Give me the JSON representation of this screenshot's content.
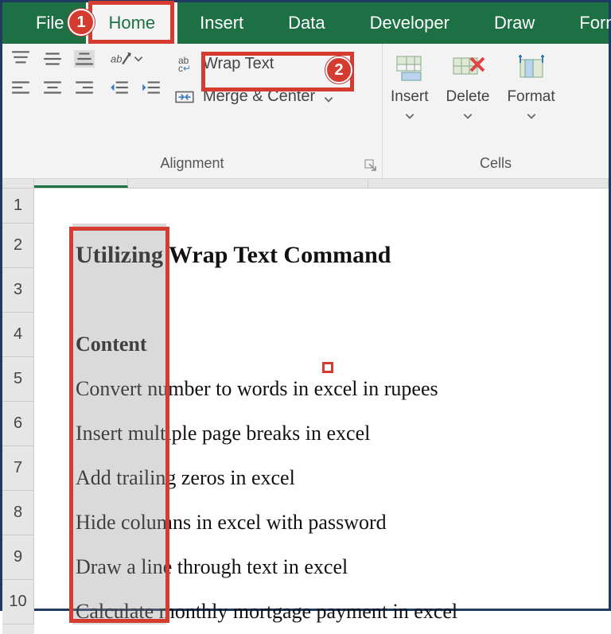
{
  "tabs": {
    "file": "File",
    "home": "Home",
    "insert": "Insert",
    "data": "Data",
    "developer": "Developer",
    "draw": "Draw",
    "formulas": "Formulas"
  },
  "ribbon": {
    "alignment_label": "Alignment",
    "cells_label": "Cells",
    "wrap_text": "Wrap Text",
    "merge_center": "Merge & Center",
    "insert": "Insert",
    "delete": "Delete",
    "format": "Format"
  },
  "callouts": {
    "one": "1",
    "two": "2"
  },
  "rows": [
    "1",
    "2",
    "3",
    "4",
    "5",
    "6",
    "7",
    "8",
    "9",
    "10"
  ],
  "cells": {
    "r1": "",
    "r2": "Utilizing Wrap Text Command",
    "r3": "",
    "r4": "Content",
    "r5": "Convert number to words in excel in rupees",
    "r6": "Insert multiple page breaks in excel",
    "r7": "Add trailing zeros in excel",
    "r8": "Hide columns in excel with password",
    "r9": "Draw a line through text in excel",
    "r10": "Calculate monthly mortgage payment in excel"
  }
}
